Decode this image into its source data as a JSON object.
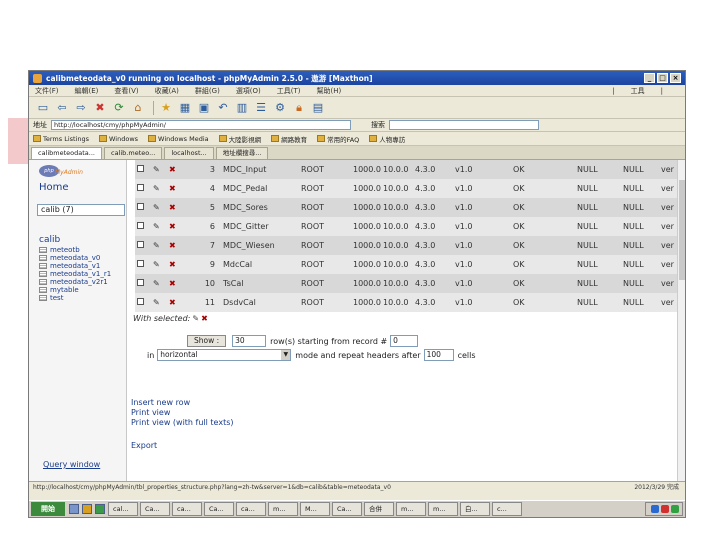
{
  "window": {
    "title": "calibmeteodata_v0 running on localhost - phpMyAdmin 2.5.0 - 遨游 [Maxthon]",
    "buttons": [
      "_",
      "□",
      "×"
    ]
  },
  "menubar": {
    "items": [
      "文件(F)",
      "編輯(E)",
      "查看(V)",
      "收藏(A)",
      "群組(G)",
      "選項(O)",
      "工具(T)",
      "幫助(H)"
    ],
    "right": [
      "|",
      "工具",
      "|"
    ]
  },
  "address": {
    "label": "地址",
    "value": "http://localhost/cmy/phpMyAdmin/",
    "search_label": "搜索",
    "search_value": ""
  },
  "favorites": [
    "Terms Listings",
    "Windows",
    "Windows Media",
    "大陸影視網",
    "網路教育",
    "常用的FAQ",
    "人物專訪"
  ],
  "tabs": [
    "calibmeteodata...",
    "calib.meteo...",
    "localhost...",
    "地址欄搜尋..."
  ],
  "sidebar": {
    "logo_php": "php",
    "logo_my": "MyAdmin",
    "home": "Home",
    "db_select": "calib (7)",
    "db_name": "calib",
    "tables": [
      "meteotb",
      "meteodata_v0",
      "meteodata_v1",
      "meteodata_v1_r1",
      "meteodata_v2r1",
      "mytable",
      "test"
    ],
    "query_window": "Query window"
  },
  "rows": [
    {
      "id": "3",
      "name": "MDC_Input",
      "user": "ROOT",
      "val": "1000.0",
      "dec": "10.0.0",
      "ver": "4.3.0",
      "v2": "v1.0",
      "ok": "OK",
      "n1": "NULL",
      "n2": "NULL",
      "v3": "ver"
    },
    {
      "id": "4",
      "name": "MDC_Pedal",
      "user": "ROOT",
      "val": "1000.0",
      "dec": "10.0.0",
      "ver": "4.3.0",
      "v2": "v1.0",
      "ok": "OK",
      "n1": "NULL",
      "n2": "NULL",
      "v3": "ver"
    },
    {
      "id": "5",
      "name": "MDC_Sores",
      "user": "ROOT",
      "val": "1000.0",
      "dec": "10.0.0",
      "ver": "4.3.0",
      "v2": "v1.0",
      "ok": "OK",
      "n1": "NULL",
      "n2": "NULL",
      "v3": "ver"
    },
    {
      "id": "6",
      "name": "MDC_Gitter",
      "user": "ROOT",
      "val": "1000.0",
      "dec": "10.0.0",
      "ver": "4.3.0",
      "v2": "v1.0",
      "ok": "OK",
      "n1": "NULL",
      "n2": "NULL",
      "v3": "ver"
    },
    {
      "id": "7",
      "name": "MDC_Wiesen",
      "user": "ROOT",
      "val": "1000.0",
      "dec": "10.0.0",
      "ver": "4.3.0",
      "v2": "v1.0",
      "ok": "OK",
      "n1": "NULL",
      "n2": "NULL",
      "v3": "ver"
    },
    {
      "id": "9",
      "name": "MdcCal",
      "user": "ROOT",
      "val": "1000.0",
      "dec": "10.0.0",
      "ver": "4.3.0",
      "v2": "v1.0",
      "ok": "OK",
      "n1": "NULL",
      "n2": "NULL",
      "v3": "ver"
    },
    {
      "id": "10",
      "name": "TsCal",
      "user": "ROOT",
      "val": "1000.0",
      "dec": "10.0.0",
      "ver": "4.3.0",
      "v2": "v1.0",
      "ok": "OK",
      "n1": "NULL",
      "n2": "NULL",
      "v3": "ver"
    },
    {
      "id": "11",
      "name": "DsdvCal",
      "user": "ROOT",
      "val": "1000.0",
      "dec": "10.0.0",
      "ver": "4.3.0",
      "v2": "v1.0",
      "ok": "OK",
      "n1": "NULL",
      "n2": "NULL",
      "v3": "ver"
    }
  ],
  "with_selected": "With selected:",
  "show_form": {
    "button": "Show :",
    "rows_value": "30",
    "rows_text": "row(s) starting from record #",
    "start_value": "0",
    "in_text": "in",
    "mode_value": "horizontal",
    "mode_text": "mode and repeat headers after",
    "repeat_value": "100",
    "cells_text": "cells"
  },
  "links": [
    "Insert new row",
    "Print view",
    "Print view (with full texts)"
  ],
  "export": "Export",
  "statusbar": {
    "url": "http://localhost/cmy/phpMyAdmin/tbl_properties_structure.php?lang=zh-tw&server=1&db=calib&table=meteodata_v0",
    "right": "2012/3/29 完成"
  },
  "taskbar": {
    "start": "開始",
    "tasks": [
      "cal...",
      "Ca...",
      "ca...",
      "Ca...",
      "ca...",
      "m...",
      "M...",
      "Ca...",
      "合併",
      "m...",
      "m...",
      "白...",
      "c..."
    ]
  }
}
